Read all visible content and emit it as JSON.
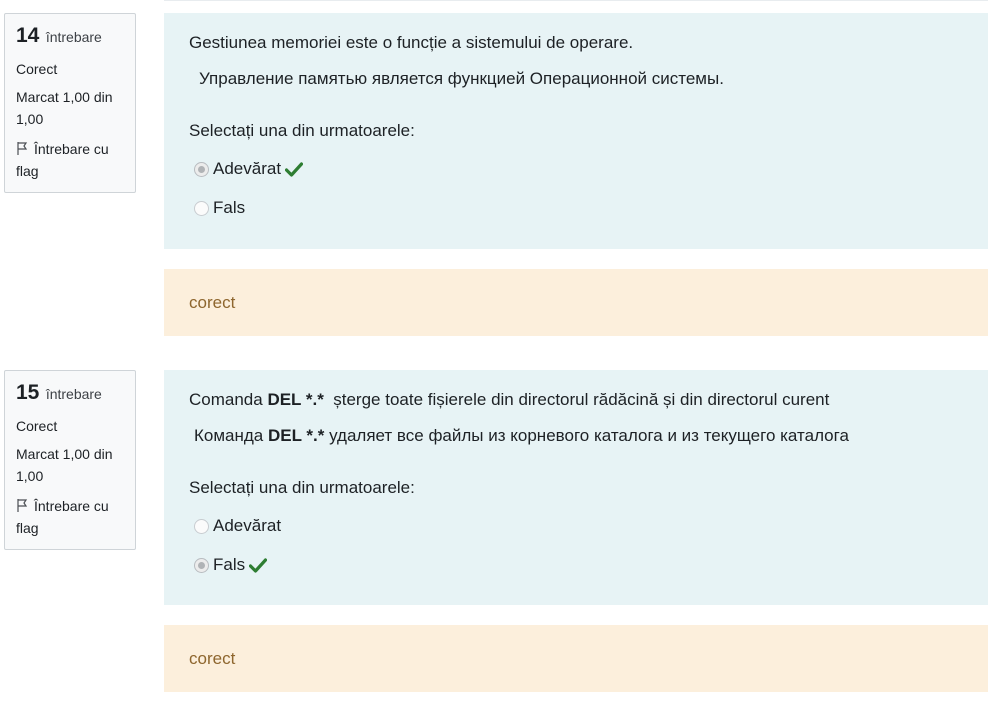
{
  "questions": [
    {
      "number": "14",
      "number_word": "întrebare",
      "state": "Corect",
      "grade": "Marcat 1,00 din 1,00",
      "flag_label": "Întrebare cu flag",
      "text_ro": "Gestiunea memoriei este o funcție a sistemului de operare.",
      "text_ru": "Управление памятью является функцией Операционной системы.",
      "prompt": "Selectați una din urmatoarele:",
      "options": [
        {
          "label": "Adevărat",
          "selected": true,
          "correct": true
        },
        {
          "label": "Fals",
          "selected": false,
          "correct": false
        }
      ],
      "feedback": "corect"
    },
    {
      "number": "15",
      "number_word": "întrebare",
      "state": "Corect",
      "grade": "Marcat 1,00 din 1,00",
      "flag_label": "Întrebare cu flag",
      "text_ro_prefix": "Comanda ",
      "text_ro_cmd": "DEL *.*",
      "text_ro_suffix": "  șterge toate fișierele din directorul rădăcină și din directorul curent",
      "text_ru_prefix": "Команда ",
      "text_ru_cmd": "DEL *.*",
      "text_ru_suffix": " удаляет все файлы из корневого каталога и из текущего каталога",
      "prompt": "Selectați una din urmatoarele:",
      "options": [
        {
          "label": "Adevărat",
          "selected": false,
          "correct": false
        },
        {
          "label": "Fals",
          "selected": true,
          "correct": true
        }
      ],
      "feedback": "corect"
    }
  ],
  "icons": {
    "flag": "flag-icon",
    "correct": "check-icon"
  },
  "colors": {
    "correct": "#2e7d32",
    "content_bg": "#e7f3f5",
    "feedback_bg": "#fcefdc",
    "feedback_text": "#8e662e"
  }
}
